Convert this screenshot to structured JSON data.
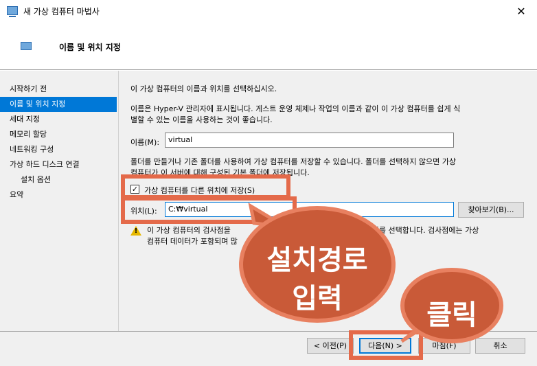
{
  "window": {
    "title": "새 가상 컴퓨터 마법사",
    "close_glyph": "✕"
  },
  "header": {
    "title": "이름 및 위치 지정"
  },
  "nav": {
    "items": [
      {
        "label": "시작하기 전",
        "active": false,
        "sub": false
      },
      {
        "label": "이름 및 위치 지정",
        "active": true,
        "sub": false
      },
      {
        "label": "세대 지정",
        "active": false,
        "sub": false
      },
      {
        "label": "메모리 할당",
        "active": false,
        "sub": false
      },
      {
        "label": "네트워킹 구성",
        "active": false,
        "sub": false
      },
      {
        "label": "가상 하드 디스크 연결",
        "active": false,
        "sub": false
      },
      {
        "label": "설치 옵션",
        "active": false,
        "sub": true
      },
      {
        "label": "요약",
        "active": false,
        "sub": false
      }
    ]
  },
  "main": {
    "intro": "이 가상 컴퓨터의 이름과 위치를 선택하십시오.",
    "name_desc_1": "이름은 Hyper-V 관리자에 표시됩니다. 게스트 운영 체제나 작업의 이름과 같이 이 가상 컴퓨터를 쉽게 식",
    "name_desc_2": "별할 수 있는 이름을 사용하는 것이 좋습니다.",
    "name_label": "이름(M):",
    "name_value": "virtual",
    "folder_desc_1": "폴더를 만들거나 기존 폴더를 사용하여 가상 컴퓨터를 저장할 수 있습니다. 폴더를 선택하지 않으면 가상",
    "folder_desc_2": "컴퓨터가 이 서버에 대해 구성된 기본 폴더에 저장됩니다.",
    "store_checkbox_label": "가상 컴퓨터를 다른 위치에 저장(S)",
    "store_checked": "✓",
    "location_label": "위치(L):",
    "location_value": "C:₩virtual",
    "browse_button": "찾아보기(B)...",
    "warning_1a": "이 가상 컴퓨터의 검사점을",
    "warning_1b": "한 위치를 선택합니다. 검사점에는 가상",
    "warning_2": "컴퓨터 데이터가 포함되며 많",
    "warning_mark": "!"
  },
  "footer": {
    "prev_button": "< 이전(P)",
    "next_button": "다음(N) >",
    "finish_button": "마침(F)",
    "cancel_button": "취소"
  },
  "annotations": {
    "bubble_1_line1": "설치경로",
    "bubble_1_line2": "입력",
    "bubble_2": "클릭"
  },
  "colors": {
    "accent": "#0078d7",
    "highlight": "#e46a4a",
    "bubble": "#c95a38"
  }
}
